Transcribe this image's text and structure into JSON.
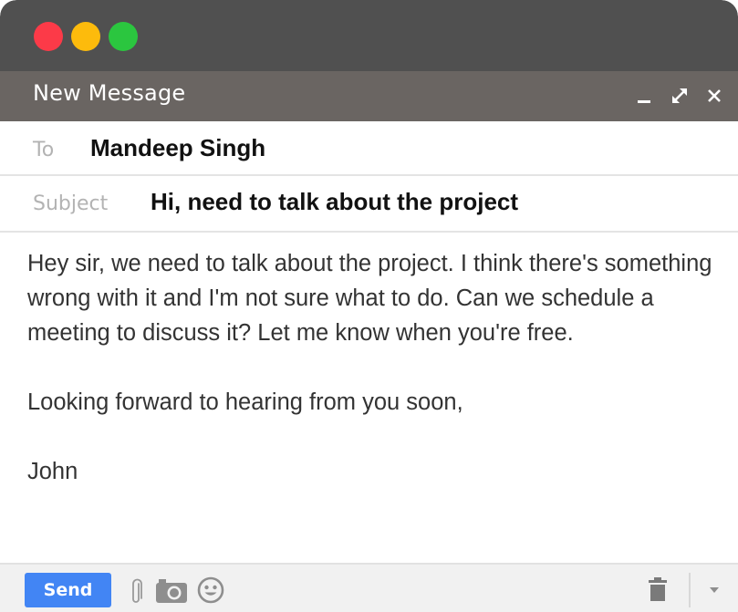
{
  "window": {
    "traffic_lights": [
      "close",
      "minimize",
      "zoom"
    ]
  },
  "header": {
    "title": "New Message",
    "controls": [
      "minimize-icon",
      "expand-icon",
      "close-icon"
    ]
  },
  "to": {
    "label": "To",
    "value": "Mandeep Singh"
  },
  "subject": {
    "label": "Subject",
    "value": "Hi, need to talk about the project"
  },
  "body": {
    "paragraph1": "Hey sir, we need to talk about the project. I think there's something wrong with it and I'm not sure what to do. Can we schedule a meeting to discuss it? Let me know when you're free.",
    "closing": "Looking forward to hearing from you soon,",
    "signature": "John"
  },
  "footer": {
    "send_label": "Send",
    "icons": [
      "paperclip-icon",
      "camera-icon",
      "smiley-icon",
      "trash-icon",
      "chevron-down-icon"
    ]
  },
  "colors": {
    "titlebar": "#505050",
    "header": "#6a6562",
    "send_button": "#4285f4",
    "close_light": "#fc3a48",
    "minimize_light": "#fdbb0c",
    "zoom_light": "#2bc63f"
  }
}
